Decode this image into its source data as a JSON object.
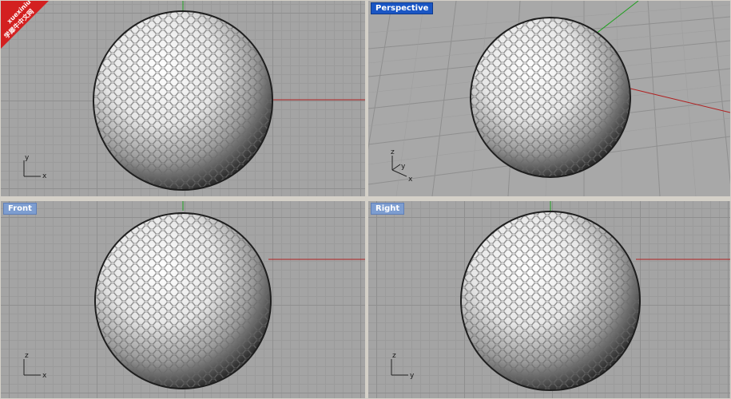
{
  "viewports": {
    "top": {
      "label": "",
      "axis_a": "x",
      "axis_b": "y"
    },
    "perspective": {
      "label": "Perspective",
      "axis_a": "x",
      "axis_b": "y",
      "axis_c": "z"
    },
    "front": {
      "label": "Front",
      "axis_a": "x",
      "axis_b": "z"
    },
    "right": {
      "label": "Right",
      "axis_a": "y",
      "axis_b": "z"
    }
  },
  "watermark": {
    "line1": "xuexiniu",
    "line2": "学犀牛中文网"
  },
  "colors": {
    "x_axis": "#b02020",
    "y_axis": "#1fa01f",
    "active_label": "#1a56c4",
    "inactive_label": "#7d9dd0"
  },
  "object": "golf-ball"
}
